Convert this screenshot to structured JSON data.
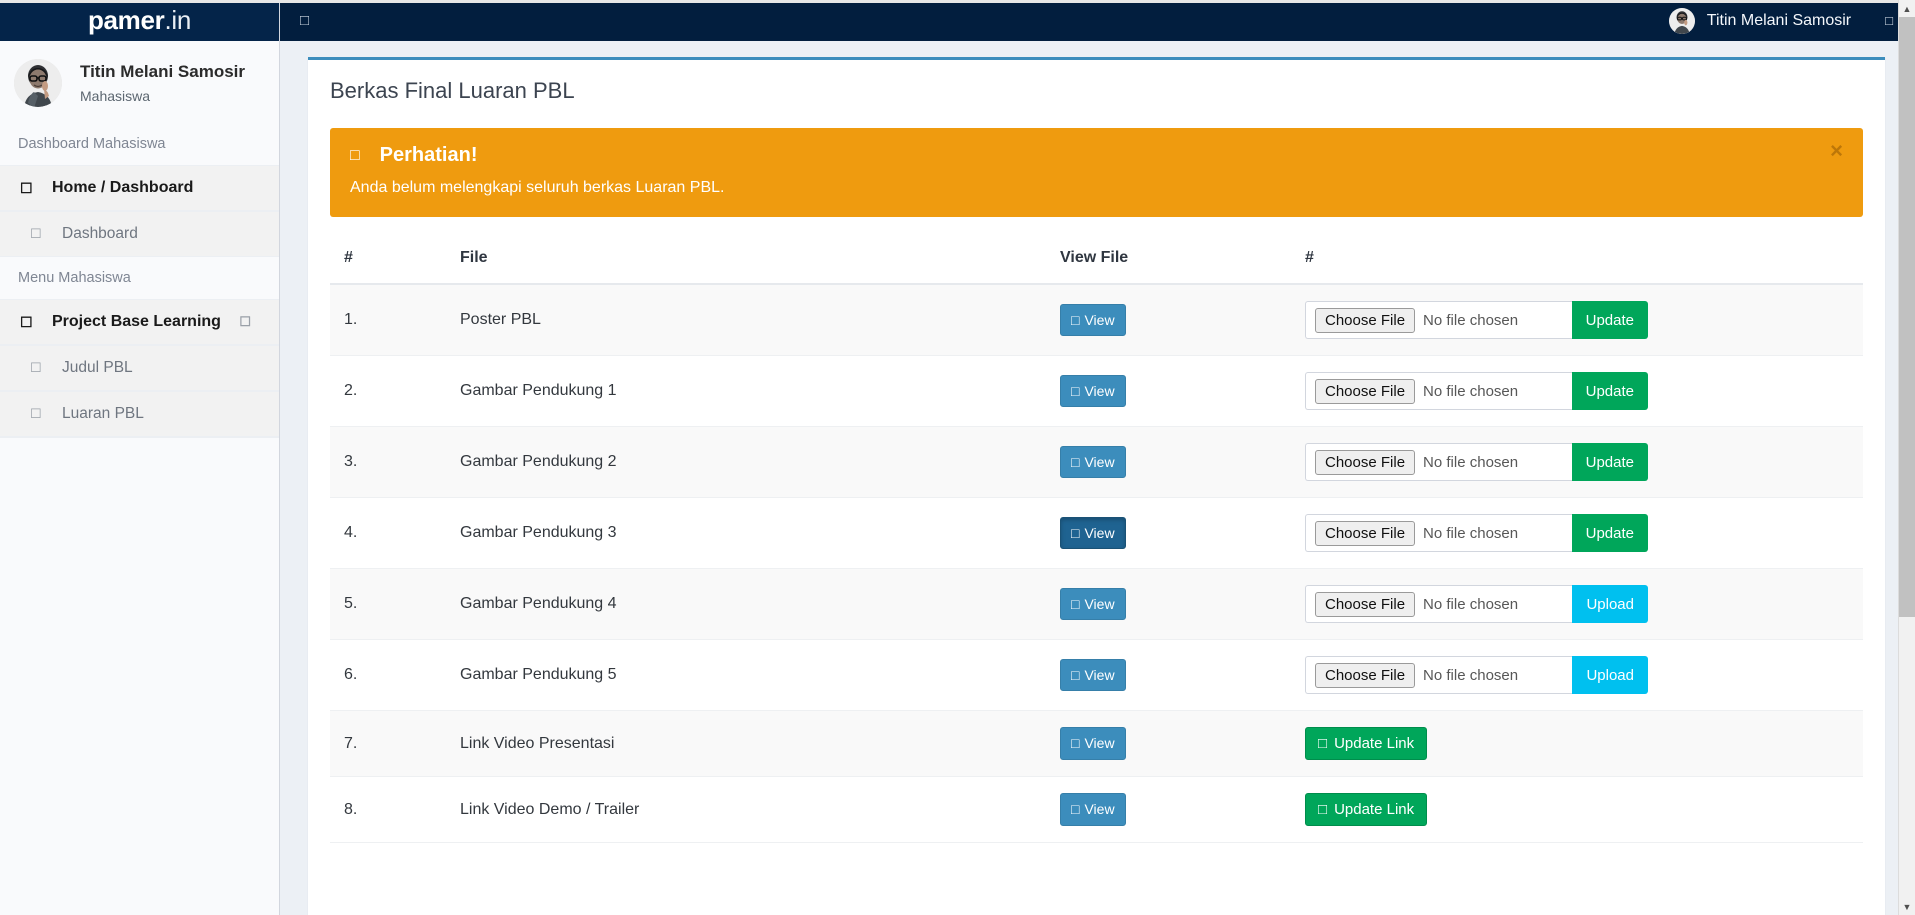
{
  "brand": {
    "name_bold": "pamer",
    "name_light": ".in"
  },
  "sidebar": {
    "user": {
      "name": "Titin Melani Samosir",
      "role": "Mahasiswa"
    },
    "section_dashboard": "Dashboard Mahasiswa",
    "section_menu": "Menu Mahasiswa",
    "items": [
      {
        "label": "Home / Dashboard",
        "icon": "square-glyph-icon"
      },
      {
        "label": "Dashboard",
        "icon": "square-glyph-icon"
      },
      {
        "label": "Project Base Learning",
        "icon": "square-glyph-icon"
      },
      {
        "label": "Judul PBL",
        "icon": "square-glyph-icon"
      },
      {
        "label": "Luaran PBL",
        "icon": "square-glyph-icon"
      }
    ]
  },
  "navbar": {
    "toggle_icon": "□",
    "user_name": "Titin Melani Samosir",
    "caret_icon": "□"
  },
  "page": {
    "title": "Berkas Final Luaran PBL"
  },
  "alert": {
    "icon": "□",
    "title": "Perhatian!",
    "body": "Anda belum melengkapi seluruh berkas Luaran PBL.",
    "close_label": "×",
    "color": "#ef9b0f"
  },
  "table": {
    "headers": {
      "num": "#",
      "file": "File",
      "view": "View File",
      "action": "#"
    },
    "view_label": "View",
    "view_icon": "□",
    "choose_file_label": "Choose File",
    "no_file_text": "No file chosen",
    "rows": [
      {
        "num": "1.",
        "file": "Poster PBL",
        "action": "upload",
        "button": "Update",
        "button_color": "green"
      },
      {
        "num": "2.",
        "file": "Gambar Pendukung 1",
        "action": "upload",
        "button": "Update",
        "button_color": "green"
      },
      {
        "num": "3.",
        "file": "Gambar Pendukung 2",
        "action": "upload",
        "button": "Update",
        "button_color": "green"
      },
      {
        "num": "4.",
        "file": "Gambar Pendukung 3",
        "action": "upload",
        "button": "Update",
        "button_color": "green",
        "view_active": true
      },
      {
        "num": "5.",
        "file": "Gambar Pendukung 4",
        "action": "upload",
        "button": "Upload",
        "button_color": "cyan"
      },
      {
        "num": "6.",
        "file": "Gambar Pendukung 5",
        "action": "upload",
        "button": "Upload",
        "button_color": "cyan"
      },
      {
        "num": "7.",
        "file": "Link Video Presentasi",
        "action": "link",
        "button": "Update Link",
        "button_color": "green"
      },
      {
        "num": "8.",
        "file": "Link Video Demo / Trailer",
        "action": "link",
        "button": "Update Link",
        "button_color": "green"
      }
    ]
  },
  "colors": {
    "navbar": "#021e3e",
    "logo_bar": "#042449",
    "card_top_border": "#3c8dbc",
    "view_button": "#3c8dbc",
    "green": "#00a65a",
    "cyan": "#00c0ef",
    "alert_orange": "#ef9b0f"
  }
}
